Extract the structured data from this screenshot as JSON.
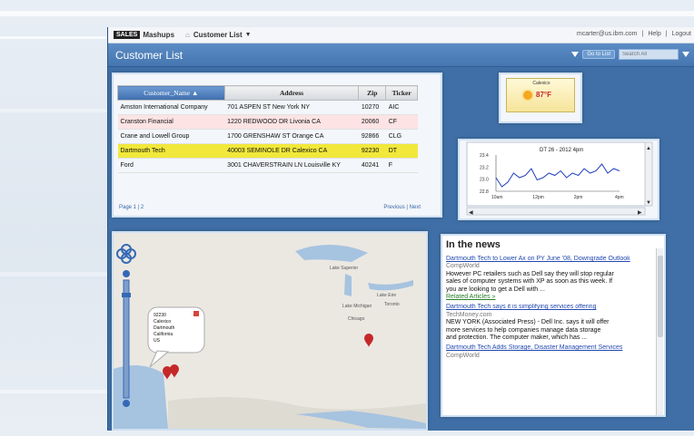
{
  "topbar": {
    "logo_box": "SALES",
    "logo_text": "Mashups",
    "nav_item": "Customer List",
    "user_email": "mcarter@us.ibm.com",
    "help_link": "Help",
    "logout_link": "Logout"
  },
  "titlebar": {
    "title": "Customer List",
    "go_button": "Go to List",
    "search_placeholder": "Search All"
  },
  "customer_grid": {
    "columns": [
      "Customer_Name",
      "Address",
      "Zip",
      "Ticker"
    ],
    "rows": [
      {
        "name": "Amston International Company",
        "address": "701 ASPEN ST New York NY",
        "zip": "10270",
        "ticker": "AIC",
        "style": "normal"
      },
      {
        "name": "Cranston Financial",
        "address": "1220 REDWOOD DR Livonia CA",
        "zip": "20060",
        "ticker": "CF",
        "style": "pink"
      },
      {
        "name": "Crane and Lowell Group",
        "address": "1700 GRENSHAW ST Orange CA",
        "zip": "92866",
        "ticker": "CLG",
        "style": "normal"
      },
      {
        "name": "Dartmouth Tech",
        "address": "40003 SEMINOLE DR Calexico CA",
        "zip": "92230",
        "ticker": "DT",
        "style": "selected"
      },
      {
        "name": "Ford",
        "address": "3001 CHAVERSTRAIN LN Louisville KY",
        "zip": "40241",
        "ticker": "F",
        "style": "normal"
      }
    ],
    "page_label": "Page 1 | 2",
    "pager_prev": "Previous",
    "pager_next": "Next"
  },
  "weather": {
    "location": "Calexico",
    "temperature": "87°F",
    "condition_icon": "sun-icon",
    "panel_color": "#f6e49a"
  },
  "stock_chart": {
    "title": "DT 26 - 2012 4pm",
    "chart_data": {
      "type": "line",
      "title": "DT 26 - 2012 4pm",
      "xlabel": "",
      "ylabel": "",
      "x_ticks": [
        "10am",
        "12pm",
        "2pm",
        "4pm"
      ],
      "y_ticks": [
        "23.4",
        "23.2",
        "23.0",
        "22.8"
      ],
      "ylim": [
        22.7,
        23.5
      ],
      "series": [
        {
          "values": [
            23.0,
            22.8,
            22.9,
            23.1,
            23.0,
            23.05,
            23.2,
            22.95,
            23.0,
            23.1,
            23.05,
            23.15,
            23.0,
            23.1,
            23.05,
            23.2,
            23.1,
            23.15,
            23.3,
            23.1,
            23.2,
            23.15
          ]
        }
      ],
      "grid": false,
      "line_color": "#1f3fbf"
    }
  },
  "map": {
    "labels": [
      "Lake Superior",
      "Lake Michigan",
      "Toronto",
      "Chicago",
      "Lake Erie"
    ],
    "popup_lines": [
      "92230",
      "Calexico",
      "Dartmouth",
      "California",
      "US"
    ],
    "marker_color": "#c62828"
  },
  "news": {
    "heading": "In the news",
    "items": [
      {
        "title": "Dartmouth Tech to Lower Ax on PY June '08, Downgrade Outlook",
        "source": "CompWorld",
        "snippet": [
          "However PC retailers such as Dell say they will stop regular",
          "sales of computer systems with XP as soon as this week. If",
          "you are looking to get a Dell with ..."
        ],
        "related": "Related Articles »"
      },
      {
        "title": "Dartmouth Tech says it is simplifying services offering",
        "source": "TechMoney.com",
        "snippet": [
          "NEW YORK (Associated Press) - Dell Inc. says it will offer",
          "more services to help companies manage data storage",
          "and protection. The computer maker, which has ..."
        ]
      },
      {
        "title": "Dartmouth Tech Adds Storage, Disaster Management Services",
        "source": "CompWorld"
      }
    ]
  }
}
